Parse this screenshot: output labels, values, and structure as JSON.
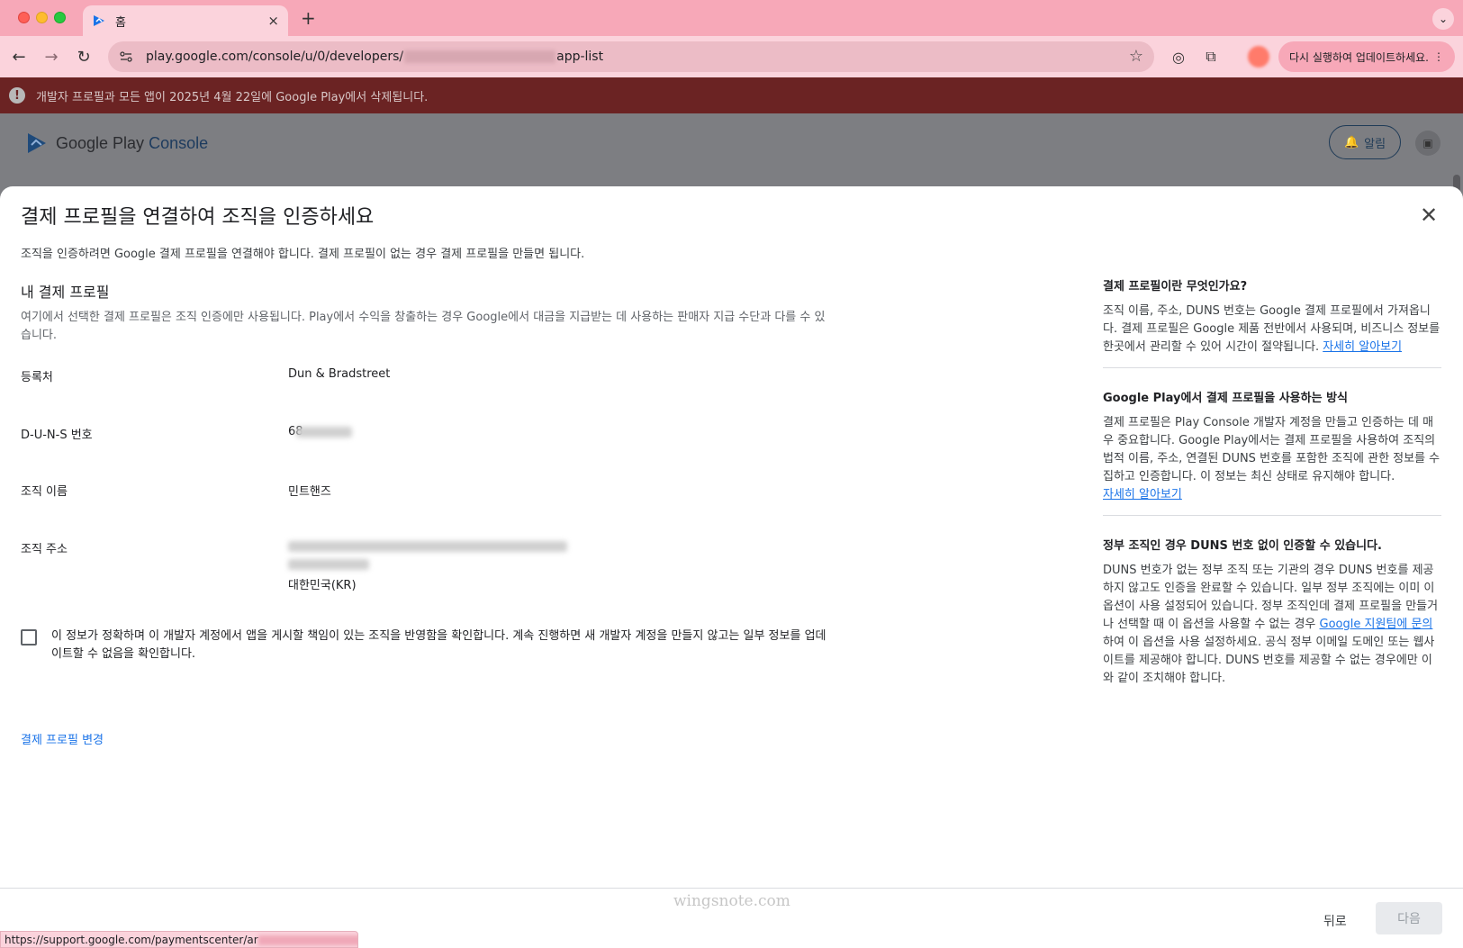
{
  "browser": {
    "tab_title": "홈",
    "tab_close": "×",
    "new_tab": "+",
    "url_prefix": "play.google.com/console/u/0/developers/",
    "url_suffix": "app-list",
    "update_button": "다시 실행하여 업데이트하세요.",
    "status_url": "https://support.google.com/paymentscenter/ar"
  },
  "banner": {
    "text": "개발자 프로필과 모든 앱이 2025년 4월 22일에 Google Play에서 삭제됩니다."
  },
  "header": {
    "logo_google_play": "Google Play",
    "logo_console": "Console",
    "alert_label": "알림"
  },
  "modal": {
    "title": "결제 프로필을 연결하여 조직을 인증하세요",
    "description": "조직을 인증하려면 Google 결제 프로필을 연결해야 합니다. 결제 프로필이 없는 경우 결제 프로필을 만들면 됩니다.",
    "section_title": "내 결제 프로필",
    "section_desc": "여기에서 선택한 결제 프로필은 조직 인증에만 사용됩니다. Play에서 수익을 창출하는 경우 Google에서 대금을 지급받는 데 사용하는 판매자 지급 수단과 다를 수 있습니다.",
    "fields": [
      {
        "label": "등록처",
        "value": "Dun & Bradstreet"
      },
      {
        "label": "D-U-N-S 번호",
        "value": "68"
      },
      {
        "label": "조직 이름",
        "value": "민트핸즈"
      },
      {
        "label": "조직 주소",
        "value": "대한민국(KR)"
      }
    ],
    "confirm_text": "이 정보가 정확하며 이 개발자 계정에서 앱을 게시할 책임이 있는 조직을 반영함을 확인합니다. 계속 진행하면 새 개발자 계정을 만들지 않고는 일부 정보를 업데이트할 수 없음을 확인합니다.",
    "change_link": "결제 프로필 변경",
    "back_button": "뒤로",
    "next_button": "다음"
  },
  "side": {
    "h1": "결제 프로필이란 무엇인가요?",
    "p1": "조직 이름, 주소, DUNS 번호는 Google 결제 프로필에서 가져옵니다. 결제 프로필은 Google 제품 전반에서 사용되며, 비즈니스 정보를 한곳에서 관리할 수 있어 시간이 절약됩니다.",
    "link1": "자세히 알아보기",
    "h2": "Google Play에서 결제 프로필을 사용하는 방식",
    "p2": "결제 프로필은 Play Console 개발자 계정을 만들고 인증하는 데 매우 중요합니다. Google Play에서는 결제 프로필을 사용하여 조직의 법적 이름, 주소, 연결된 DUNS 번호를 포함한 조직에 관한 정보를 수집하고 인증합니다. 이 정보는 최신 상태로 유지해야 합니다.",
    "link2": "자세히 알아보기",
    "h3": "정부 조직인 경우 DUNS 번호 없이 인증할 수 있습니다.",
    "p3a": "DUNS 번호가 없는 정부 조직 또는 기관의 경우 DUNS 번호를 제공하지 않고도 인증을 완료할 수 있습니다. 일부 정부 조직에는 이미 이 옵션이 사용 설정되어 있습니다. 정부 조직인데 결제 프로필을 만들거나 선택할 때 이 옵션을 사용할 수 없는 경우 ",
    "link3": "Google 지원팀에 문의",
    "p3b": "하여 이 옵션을 사용 설정하세요. 공식 정부 이메일 도메인 또는 웹사이트를 제공해야 합니다. DUNS 번호를 제공할 수 없는 경우에만 이와 같이 조치해야 합니다."
  },
  "watermark": "wingsnote.com"
}
